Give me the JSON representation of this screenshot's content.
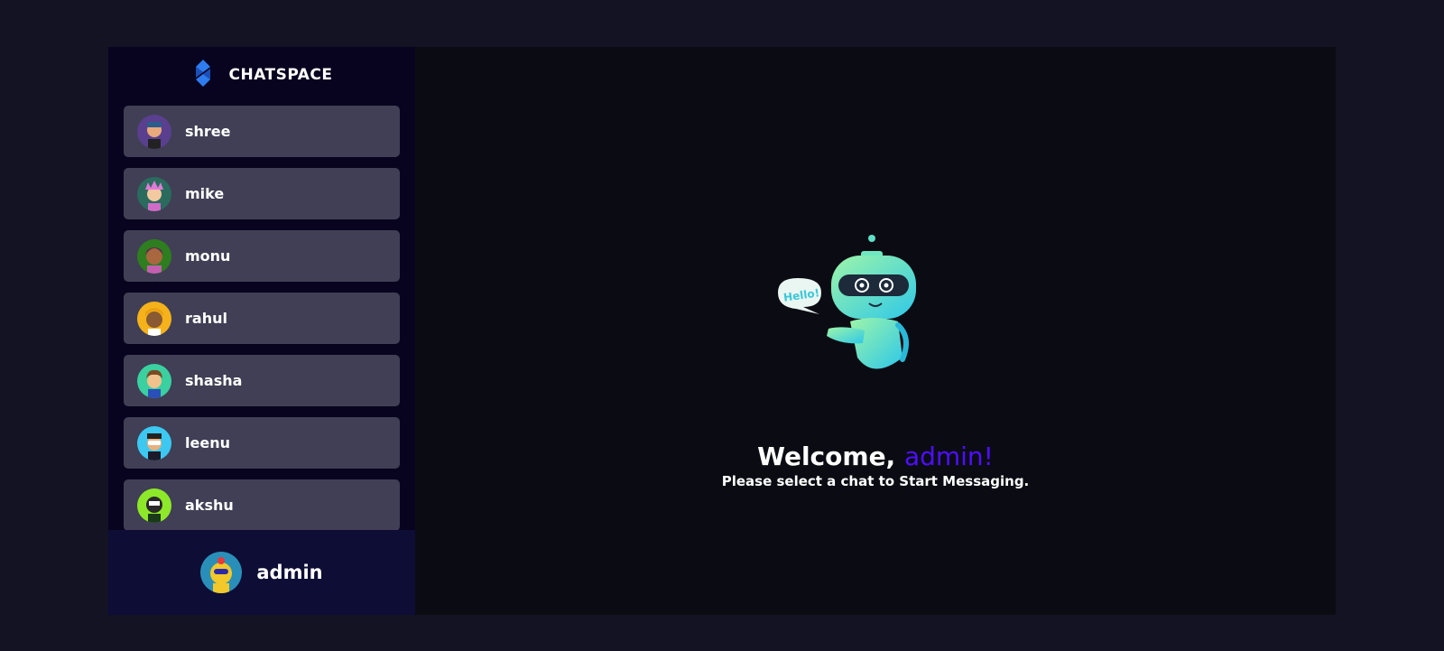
{
  "brand": {
    "name": "CHATSPACE",
    "logo_icon": "chatspace-logo-icon",
    "accent": "#1d5bd6"
  },
  "contacts": [
    {
      "name": "shree",
      "avatar_color": "#5a3f8f"
    },
    {
      "name": "mike",
      "avatar_color": "#2a6b5e"
    },
    {
      "name": "monu",
      "avatar_color": "#2e7d1f"
    },
    {
      "name": "rahul",
      "avatar_color": "#f5b21a"
    },
    {
      "name": "shasha",
      "avatar_color": "#3ad0a0"
    },
    {
      "name": "leenu",
      "avatar_color": "#3cc8f0"
    },
    {
      "name": "akshu",
      "avatar_color": "#8ee82a"
    }
  ],
  "current_user": {
    "name": "admin",
    "avatar_color": "#2a8fb8"
  },
  "welcome": {
    "greeting": "Welcome, ",
    "username": "admin!",
    "subtitle": "Please select a chat to Start Messaging.",
    "robot_bubble": "Hello!",
    "accent": "#4e0eff"
  }
}
